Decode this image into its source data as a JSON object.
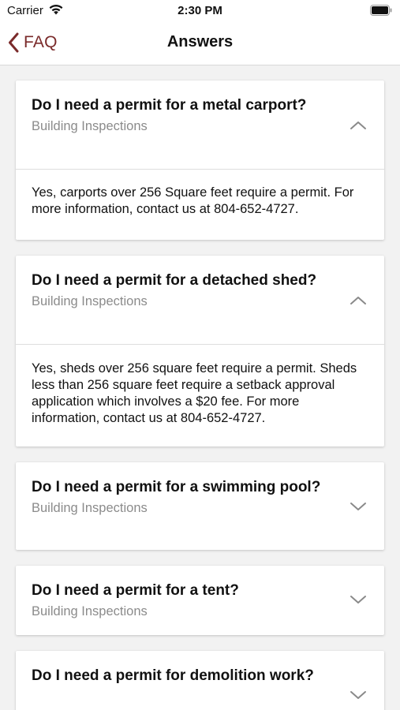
{
  "status_bar": {
    "carrier": "Carrier",
    "time": "2:30 PM"
  },
  "nav": {
    "back_label": "FAQ",
    "title": "Answers"
  },
  "colors": {
    "accent": "#7a2a2a",
    "muted_text": "#8b8b8b",
    "background": "#f2f2f2"
  },
  "faqs": [
    {
      "question": "Do I need a permit for a metal carport?",
      "category": "Building Inspections",
      "expanded": true,
      "answer": "Yes, carports over 256 Square feet require a permit. For more information, contact us at 804-652-4727."
    },
    {
      "question": "Do I need a permit for a detached shed?",
      "category": "Building Inspections",
      "expanded": true,
      "answer": "Yes, sheds over 256 square feet require a permit. Sheds less than 256 square feet require a setback approval application which involves a $20 fee. For more information, contact us at 804-652-4727."
    },
    {
      "question": "Do I need a permit for a swimming pool?",
      "category": "Building Inspections",
      "expanded": false
    },
    {
      "question": "Do I need a permit for a tent?",
      "category": "Building Inspections",
      "expanded": false
    },
    {
      "question": "Do I need a permit for demolition work?",
      "expanded": false
    }
  ]
}
